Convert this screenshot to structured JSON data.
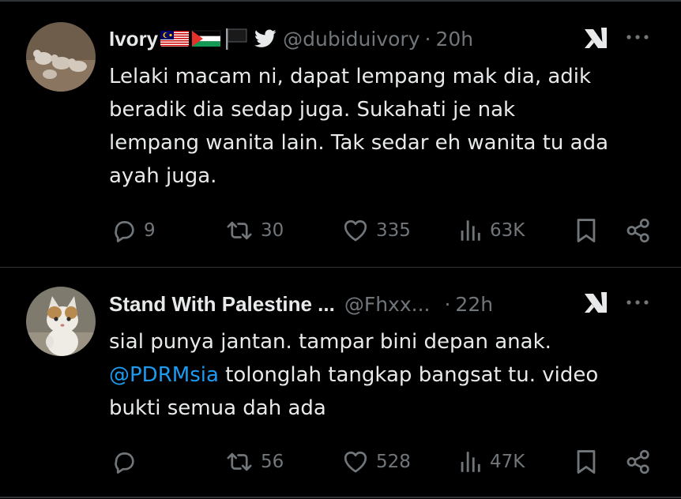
{
  "tweets": [
    {
      "display_name": "Ivory",
      "handle": "@dubiduivory",
      "separator": "·",
      "time": "20h",
      "body_lines": [
        "Lelaki macam ni, dapat lempang mak dia, adik",
        "beradik dia sedap juga. Sukahati je nak",
        "lempang wanita lain. Tak sedar eh wanita tu ada",
        "ayah juga."
      ],
      "replies": "9",
      "retweets": "30",
      "likes": "335",
      "views": "63K",
      "avatar_icon": "rabbits-photo-avatar",
      "name_badges": [
        "malaysia-flag",
        "palestine-flag",
        "black-flag",
        "twitter-bird"
      ]
    },
    {
      "display_name": "Stand With Palestine ...",
      "handle": "@Fhxx...",
      "separator": "·",
      "time": "22h",
      "body_line1": "sial punya jantan. tampar bini depan anak.",
      "mention": "@PDRMsia",
      "body_line2_rest": " tolonglah tangkap bangsat tu. video",
      "body_line3": "bukti semua dah ada",
      "replies": "",
      "retweets": "56",
      "likes": "528",
      "views": "47K",
      "avatar_icon": "cat-photo-avatar"
    }
  ],
  "colors": {
    "background": "#000000",
    "primary_text": "#e7e9ea",
    "secondary_text": "#71767b",
    "link": "#1d9bf0",
    "divider": "#2f3336"
  }
}
